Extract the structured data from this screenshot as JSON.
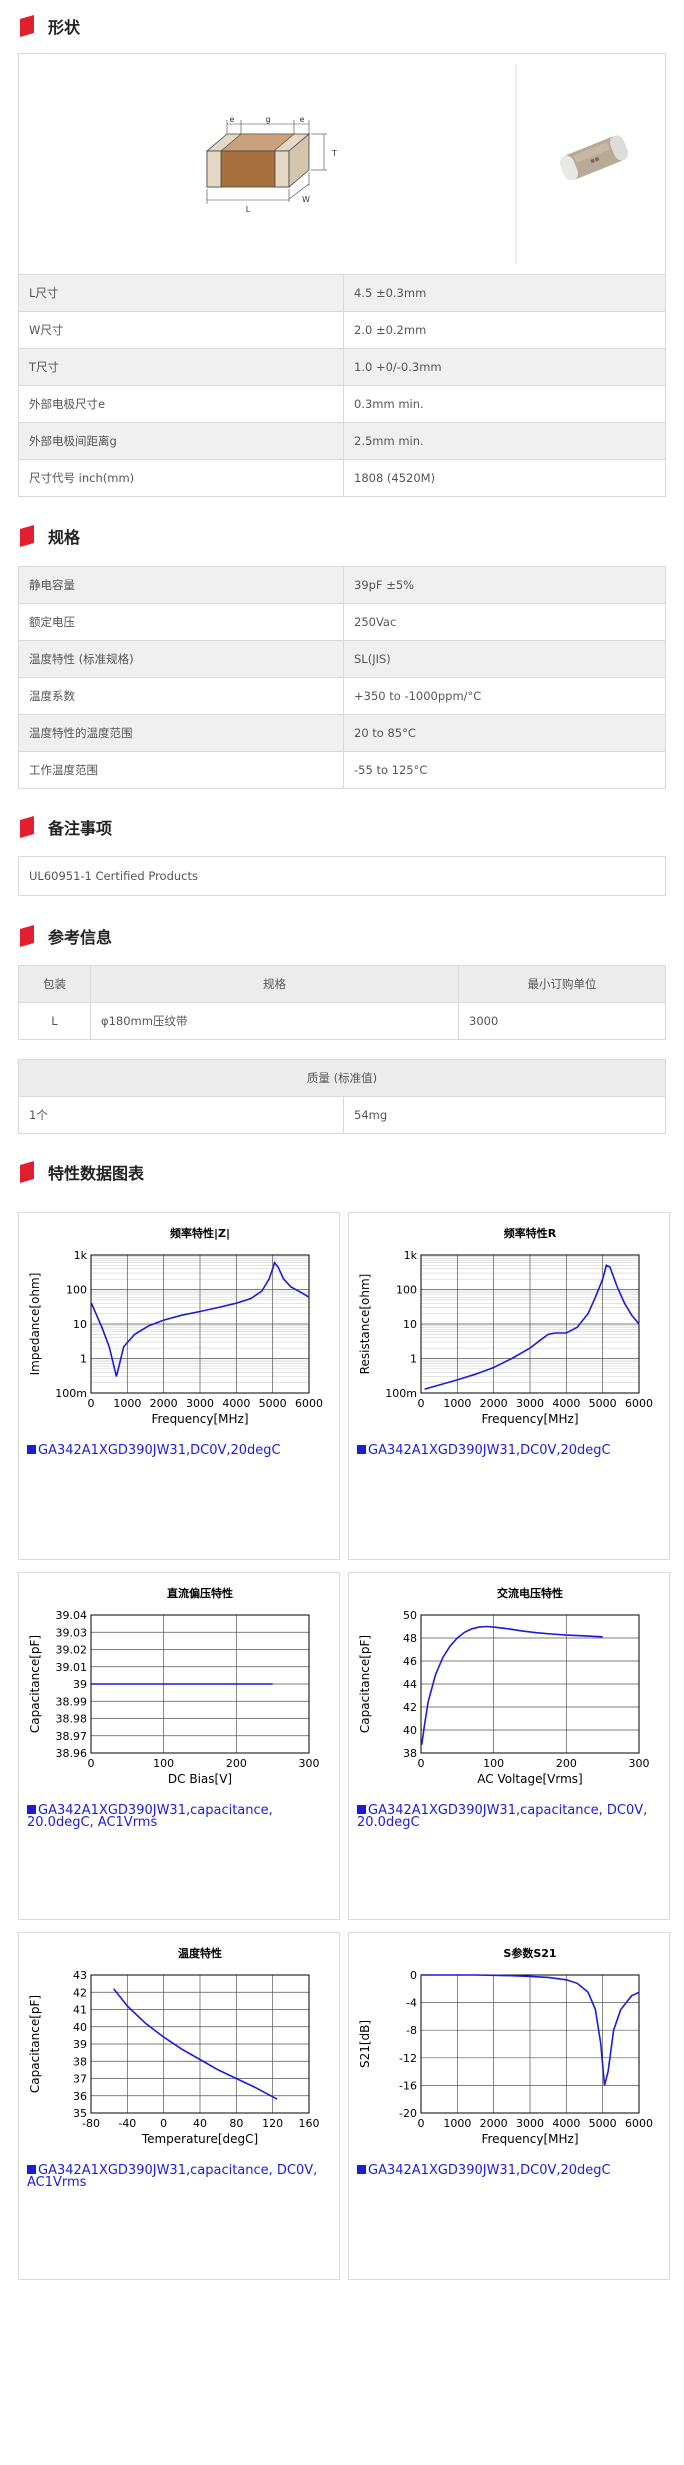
{
  "sections": {
    "shape": "形状",
    "spec": "规格",
    "notes": "备注事项",
    "ref": "参考信息",
    "charts": "特性数据图表"
  },
  "shape_dims": {
    "e": "e",
    "g": "g",
    "T": "T",
    "W": "W",
    "L": "L"
  },
  "shape_table": [
    [
      "L尺寸",
      "4.5 ±0.3mm"
    ],
    [
      "W尺寸",
      "2.0 ±0.2mm"
    ],
    [
      "T尺寸",
      "1.0 +0/-0.3mm"
    ],
    [
      "外部电极尺寸e",
      "0.3mm min."
    ],
    [
      "外部电极间距离g",
      "2.5mm min."
    ],
    [
      "尺寸代号 inch(mm)",
      "1808 (4520M)"
    ]
  ],
  "spec_table": [
    [
      "静电容量",
      "39pF ±5%"
    ],
    [
      "额定电压",
      "250Vac"
    ],
    [
      "温度特性 (标准规格)",
      "SL(JIS)"
    ],
    [
      "温度系数",
      "+350 to -1000ppm/°C"
    ],
    [
      "温度特性的温度范围",
      "20 to 85°C"
    ],
    [
      "工作温度范围",
      "-55 to 125°C"
    ]
  ],
  "notes_text": "UL60951-1 Certified Products",
  "packaging": {
    "headers": [
      "包装",
      "规格",
      "最小订购单位"
    ],
    "row": [
      "L",
      "φ180mm压纹带",
      "3000"
    ]
  },
  "mass": {
    "header": "质量 (标准值)",
    "row": [
      "1个",
      "54mg"
    ]
  },
  "colors": {
    "accent": "#e0202e",
    "series": "#1c1cd6"
  },
  "chart_data": [
    {
      "type": "line",
      "title": "频率特性|Z|",
      "xlabel": "Frequency[MHz]",
      "ylabel": "Impedance[ohm]",
      "xlim": [
        0,
        6000
      ],
      "xticks": [
        0,
        1000,
        2000,
        3000,
        4000,
        5000,
        6000
      ],
      "ylog": true,
      "ylim": [
        0.1,
        1000
      ],
      "yticks": [
        "100m",
        "1",
        "10",
        "100",
        "1k"
      ],
      "x": [
        10,
        300,
        500,
        650,
        700,
        750,
        900,
        1200,
        1600,
        2000,
        2500,
        3000,
        3500,
        4000,
        4400,
        4700,
        4900,
        5000,
        5050,
        5150,
        5300,
        5500,
        5800,
        6000
      ],
      "y": [
        40,
        8,
        2.2,
        0.5,
        0.3,
        0.5,
        2.2,
        5,
        9,
        13,
        18,
        23,
        30,
        40,
        55,
        90,
        200,
        400,
        600,
        450,
        200,
        120,
        80,
        60
      ],
      "legend": "GA342A1XGD390JW31,DC0V,20degC"
    },
    {
      "type": "line",
      "title": "频率特性R",
      "xlabel": "Frequency[MHz]",
      "ylabel": "Resistance[ohm]",
      "xlim": [
        0,
        6000
      ],
      "xticks": [
        0,
        1000,
        2000,
        3000,
        4000,
        5000,
        6000
      ],
      "ylog": true,
      "ylim": [
        0.1,
        1000
      ],
      "yticks": [
        "100m",
        "1",
        "10",
        "100",
        "1k"
      ],
      "x": [
        100,
        500,
        1000,
        1500,
        2000,
        2500,
        3000,
        3300,
        3500,
        3700,
        4000,
        4300,
        4600,
        4800,
        5000,
        5100,
        5200,
        5400,
        5600,
        5800,
        6000
      ],
      "y": [
        0.13,
        0.17,
        0.24,
        0.35,
        0.55,
        1.0,
        2.0,
        3.5,
        5,
        5.5,
        5.5,
        8,
        20,
        60,
        200,
        500,
        450,
        120,
        40,
        18,
        10
      ],
      "legend": "GA342A1XGD390JW31,DC0V,20degC"
    },
    {
      "type": "line",
      "title": "直流偏压特性",
      "xlabel": "DC Bias[V]",
      "ylabel": "Capacitance[pF]",
      "xlim": [
        0,
        300
      ],
      "xticks": [
        0,
        100,
        200,
        300
      ],
      "ylim": [
        38.96,
        39.04
      ],
      "yticks": [
        "38.96",
        "38.97",
        "38.98",
        "38.99",
        "39",
        "39.01",
        "39.02",
        "39.03",
        "39.04"
      ],
      "x": [
        0,
        250
      ],
      "y": [
        39.0,
        39.0
      ],
      "legend": "GA342A1XGD390JW31,capacitance, 20.0degC, AC1Vrms"
    },
    {
      "type": "line",
      "title": "交流电压特性",
      "xlabel": "AC Voltage[Vrms]",
      "ylabel": "Capacitance[pF]",
      "xlim": [
        0,
        300
      ],
      "xticks": [
        0,
        100,
        200,
        300
      ],
      "ylim": [
        38,
        50
      ],
      "yticks": [
        "38",
        "40",
        "42",
        "44",
        "46",
        "48",
        "50"
      ],
      "x": [
        1,
        5,
        10,
        20,
        30,
        40,
        50,
        60,
        70,
        80,
        90,
        100,
        120,
        140,
        160,
        180,
        200,
        220,
        250
      ],
      "y": [
        38.7,
        40.5,
        42.5,
        44.8,
        46.3,
        47.3,
        48.0,
        48.5,
        48.8,
        48.95,
        49.0,
        48.95,
        48.8,
        48.6,
        48.45,
        48.35,
        48.25,
        48.2,
        48.1
      ],
      "legend": "GA342A1XGD390JW31,capacitance, DC0V, 20.0degC"
    },
    {
      "type": "line",
      "title": "温度特性",
      "xlabel": "Temperature[degC]",
      "ylabel": "Capacitance[pF]",
      "xlim": [
        -80,
        160
      ],
      "xticks": [
        -80,
        -40,
        0,
        40,
        80,
        120,
        160
      ],
      "ylim": [
        35,
        43
      ],
      "yticks": [
        "35",
        "36",
        "37",
        "38",
        "39",
        "40",
        "41",
        "42",
        "43"
      ],
      "x": [
        -55,
        -40,
        -20,
        0,
        20,
        40,
        60,
        80,
        100,
        125
      ],
      "y": [
        42.2,
        41.2,
        40.2,
        39.4,
        38.7,
        38.1,
        37.5,
        37.0,
        36.5,
        35.8
      ],
      "legend": "GA342A1XGD390JW31,capacitance, DC0V, AC1Vrms"
    },
    {
      "type": "line",
      "title": "S参数S21",
      "xlabel": "Frequency[MHz]",
      "ylabel": "S21[dB]",
      "xlim": [
        0,
        6000
      ],
      "xticks": [
        0,
        1000,
        2000,
        3000,
        4000,
        5000,
        6000
      ],
      "ylim": [
        -20,
        0
      ],
      "yticks": [
        "-20",
        "-16",
        "-12",
        "-8",
        "-4",
        "0"
      ],
      "x": [
        0,
        500,
        1000,
        1500,
        2000,
        2500,
        3000,
        3500,
        4000,
        4300,
        4600,
        4800,
        4950,
        5050,
        5150,
        5300,
        5500,
        5800,
        6000
      ],
      "y": [
        0,
        0,
        0,
        0,
        -0.05,
        -0.1,
        -0.2,
        -0.35,
        -0.7,
        -1.2,
        -2.5,
        -5,
        -10,
        -16,
        -14,
        -8,
        -5,
        -3,
        -2.5
      ],
      "legend": "GA342A1XGD390JW31,DC0V,20degC"
    }
  ]
}
